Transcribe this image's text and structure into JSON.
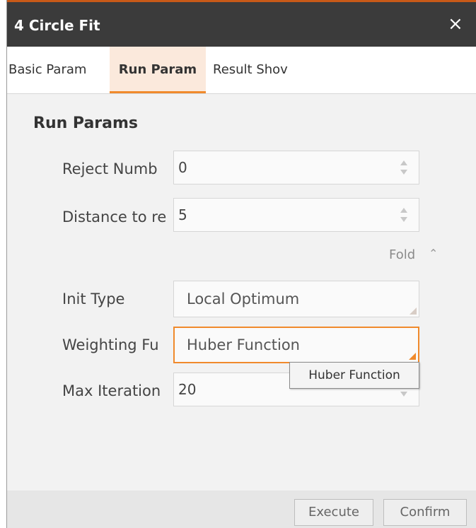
{
  "window": {
    "title": "4 Circle Fit",
    "close_icon": "×"
  },
  "tabs": [
    {
      "label": "Basic Param",
      "active": false
    },
    {
      "label": "Run Param",
      "active": true
    },
    {
      "label": "Result Shov",
      "active": false
    }
  ],
  "run_params": {
    "section_title": "Run Params",
    "reject_number": {
      "label": "Reject Numb",
      "value": "0"
    },
    "distance": {
      "label": "Distance to re",
      "value": "5"
    },
    "fold": {
      "label": "Fold",
      "icon": "chevron-up-icon"
    },
    "init_type": {
      "label": "Init Type",
      "value": "Local Optimum"
    },
    "weighting_function": {
      "label": "Weighting Fu",
      "value": "Huber Function",
      "tooltip": "Huber Function"
    },
    "max_iteration": {
      "label": "Max Iteration",
      "value": "20"
    }
  },
  "footer": {
    "execute_label": "Execute",
    "confirm_label": "Confirm"
  },
  "colors": {
    "accent": "#f08a2c",
    "title_bar": "#3b3b3b",
    "active_tab_bg": "#fbe9dc"
  }
}
